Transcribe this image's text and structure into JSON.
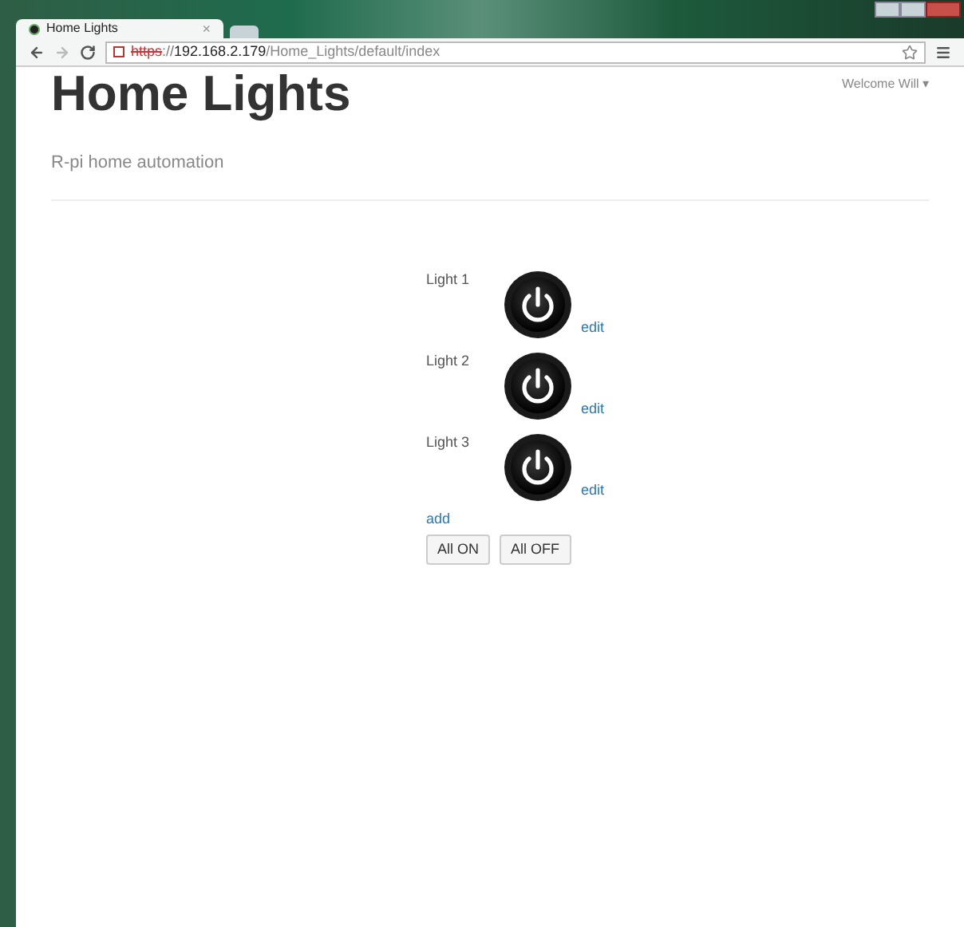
{
  "browser": {
    "tab_title": "Home Lights",
    "tab_close": "×",
    "url": {
      "scheme": "https",
      "separator": "://",
      "host": "192.168.2.179",
      "path": "/Home_Lights/default/index"
    }
  },
  "header": {
    "title": "Home Lights",
    "subtitle": "R-pi home automation",
    "user_menu": "Welcome Will ▾"
  },
  "lights": [
    {
      "name": "Light 1",
      "edit": "edit"
    },
    {
      "name": "Light 2",
      "edit": "edit"
    },
    {
      "name": "Light 3",
      "edit": "edit"
    }
  ],
  "add_link": "add",
  "buttons": [
    "All ON",
    "All OFF"
  ]
}
